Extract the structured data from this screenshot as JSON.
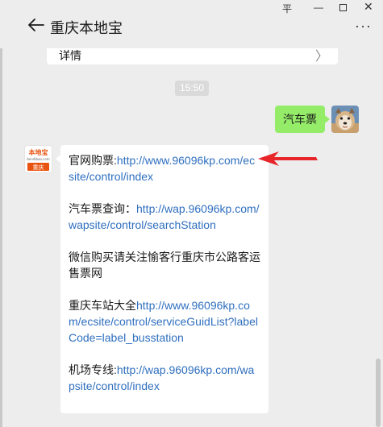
{
  "window": {
    "pin": "平",
    "minimize": "—",
    "close": "✕"
  },
  "header": {
    "title": "重庆本地宝",
    "more": "···"
  },
  "detail_card": {
    "label": "详情",
    "chevron": "〉"
  },
  "timestamp": "15:50",
  "outgoing_message": "汽车票",
  "logo": {
    "top_text": "本地宝",
    "sub_text": "bendibao.com",
    "city": "重庆"
  },
  "incoming_message": {
    "p1_prefix": "官网购票:",
    "p1_link": "http://www.96096kp.com/ecsite/control/index",
    "p2_prefix": "汽车票查询：",
    "p2_link": "http://wap.96096kp.com/wapsite/control/searchStation",
    "p3_text": "微信购买请关注愉客行重庆市公路客运售票网",
    "p4_prefix": "重庆车站大全",
    "p4_link": "http://www.96096kp.com/ecsite/control/serviceGuidList?labelCode=label_busstation",
    "p5_prefix": "机场专线:",
    "p5_link": "http://wap.96096kp.com/wapsite/control/index"
  },
  "colors": {
    "outgoing_bubble": "#95ec69",
    "link": "#2f6fbf",
    "annotation_arrow": "#e8262a"
  }
}
